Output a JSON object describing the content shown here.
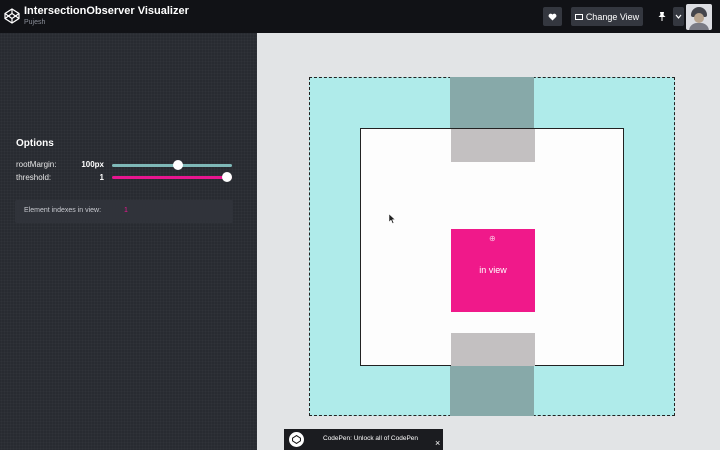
{
  "header": {
    "title": "IntersectionObserver Visualizer",
    "author": "Pujesh",
    "change_view_label": "Change View"
  },
  "options": {
    "title": "Options",
    "root_margin_label": "rootMargin:",
    "root_margin_value": "100px",
    "root_margin_fraction": 0.55,
    "threshold_label": "threshold:",
    "threshold_value": "1",
    "threshold_fraction": 1.0
  },
  "indexes": {
    "label": "Element indexes in view:",
    "value": "1"
  },
  "preview": {
    "pink_label": "in view"
  },
  "banner": {
    "text": "CodePen: Unlock all of CodePen",
    "close": "×"
  },
  "colors": {
    "accent_pink": "#f0198a",
    "accent_teal": "#afebea"
  },
  "icons": [
    "codepen-logo-icon",
    "heart-icon",
    "layout-icon",
    "pin-icon",
    "chevron-down-icon",
    "avatar",
    "mouse-cursor-icon",
    "close-icon"
  ]
}
